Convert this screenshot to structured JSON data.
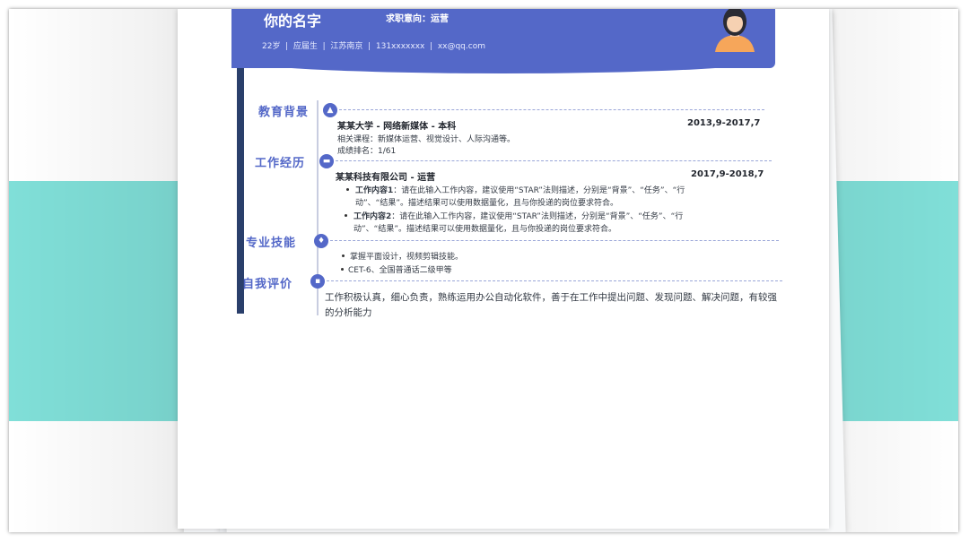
{
  "header": {
    "name": "你的名字",
    "objective": "求职意向：运营",
    "info": "22岁  |  应届生  |  江苏南京  |  131xxxxxxx  |  xx@qq.com"
  },
  "education": {
    "title": "教育背景",
    "school": "某某大学 - 网络新媒体 - 本科",
    "date": "2013,9-2017,7",
    "courses": "相关课程：新媒体运营、视觉设计、人际沟通等。",
    "rank": "成绩排名：1/61"
  },
  "work": {
    "title": "工作经历",
    "company": "某某科技有限公司 - 运营",
    "date": "2017,9-2018,7",
    "items": [
      {
        "label": "工作内容1",
        "line1": "：请在此输入工作内容，建议使用“STAR”法则描述，分别是“背景”、“任务”、“行",
        "line2": "动”、“结果”。描述结果可以使用数据量化，且与你投递的岗位要求符合。"
      },
      {
        "label": "工作内容2",
        "line1": "：请在此输入工作内容，建议使用“STAR”法则描述，分别是“背景”、“任务”、“行",
        "line2": "动”、“结果”。描述结果可以使用数据量化，且与你投递的岗位要求符合。"
      }
    ]
  },
  "skills": {
    "title": "专业技能",
    "items": [
      "掌握平面设计，视频剪辑技能。",
      "CET-6、全国普通话二级甲等"
    ]
  },
  "evaluation": {
    "title": "自我评价",
    "text": "工作积极认真，细心负责，熟练运用办公自动化软件，善于在工作中提出问题、发现问题、解决问题，有较强的分析能力"
  },
  "colors": {
    "accent": "#5468c8",
    "band": "#80dfd8"
  }
}
